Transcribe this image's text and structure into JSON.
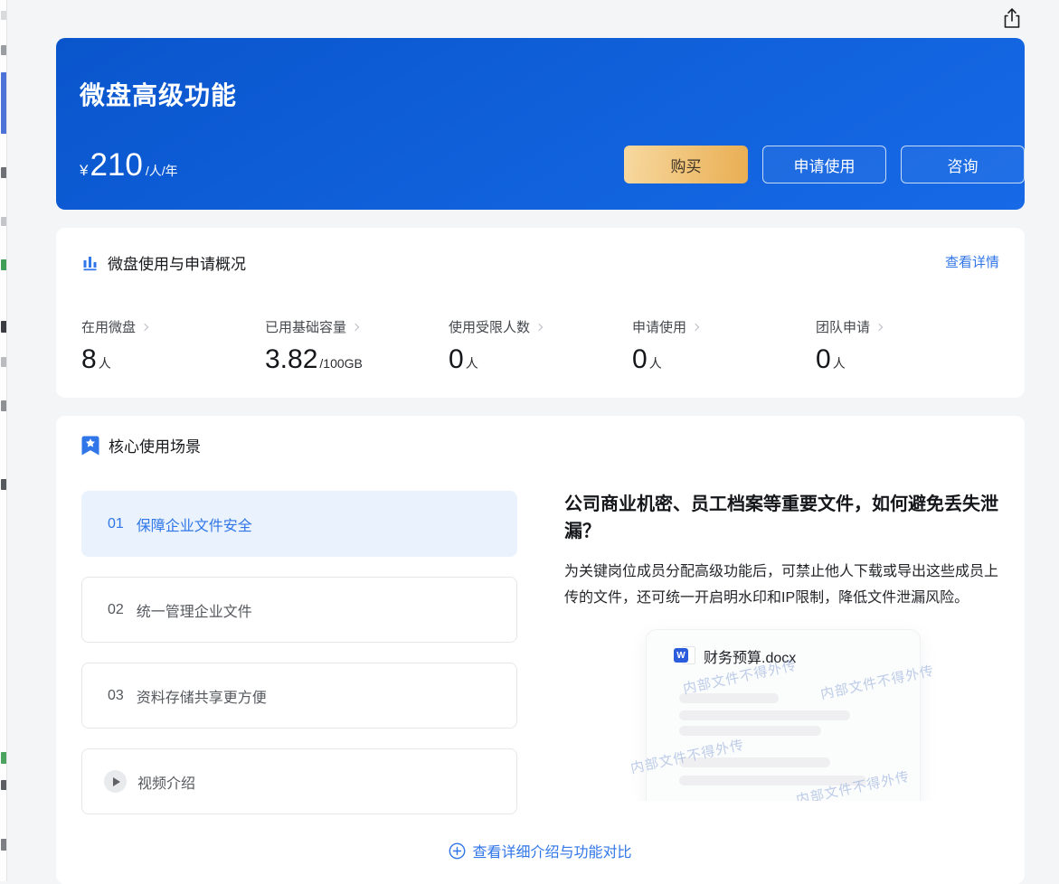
{
  "colors": {
    "banner_blue": "#0f5fd9",
    "accent_blue": "#3076e8",
    "active_item_bg": "#e9f2fd",
    "buy_gold": "#e9ae52",
    "watermark_blue": "#8aa4d8"
  },
  "topbar": {
    "share_icon": "share-icon"
  },
  "banner": {
    "title": "微盘高级功能",
    "currency": "¥",
    "price": "210",
    "unit": "/人/年",
    "buttons": [
      {
        "label": "购买",
        "style": "gold"
      },
      {
        "label": "申请使用",
        "style": "outline"
      },
      {
        "label": "咨询",
        "style": "outline"
      }
    ]
  },
  "overview": {
    "icon": "bar-chart-icon",
    "title": "微盘使用与申请概况",
    "detail_link": "查看详情",
    "stats": [
      {
        "label": "在用微盘",
        "value": "8",
        "suffix": "人"
      },
      {
        "label": "已用基础容量",
        "value": "3.82",
        "suffix": "/100GB"
      },
      {
        "label": "使用受限人数",
        "value": "0",
        "suffix": "人"
      },
      {
        "label": "申请使用",
        "value": "0",
        "suffix": "人"
      },
      {
        "label": "团队申请",
        "value": "0",
        "suffix": "人"
      }
    ]
  },
  "scenarios": {
    "icon": "bookmark-star-icon",
    "title": "核心使用场景",
    "items": [
      {
        "number": "01",
        "label": "保障企业文件安全",
        "active": true
      },
      {
        "number": "02",
        "label": "统一管理企业文件",
        "active": false
      },
      {
        "number": "03",
        "label": "资料存储共享更方便",
        "active": false
      }
    ],
    "video_item": {
      "icon": "play-icon",
      "label": "视频介绍"
    },
    "detail": {
      "heading": "公司商业机密、员工档案等重要文件，如何避免丢失泄漏？",
      "body": "为关键岗位成员分配高级功能后，可禁止他人下载或导出这些成员上传的文件，还可统一开启明水印和IP限制，降低文件泄漏风险。",
      "document": {
        "file_icon": "word-doc-icon",
        "file_icon_letter": "W",
        "file_name": "财务预算.docx",
        "watermark": "内部文件不得外传"
      }
    },
    "footer_link": {
      "icon": "plus-circle-icon",
      "label": "查看详细介绍与功能对比"
    }
  }
}
